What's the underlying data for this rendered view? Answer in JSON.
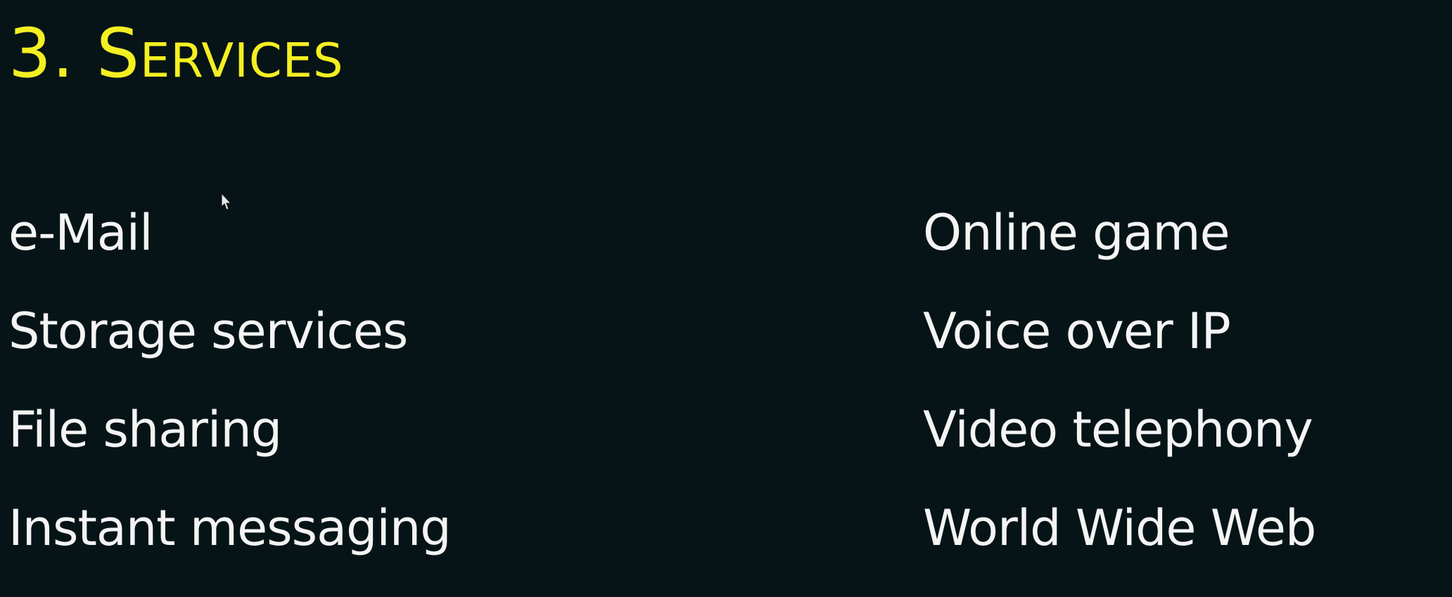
{
  "slide": {
    "title": "3. Services",
    "left_items": [
      {
        "label": "e-Mail"
      },
      {
        "label": "Storage services"
      },
      {
        "label": "File sharing"
      },
      {
        "label": "Instant messaging"
      }
    ],
    "right_items": [
      {
        "label": "Online game"
      },
      {
        "label": "Voice over IP"
      },
      {
        "label": "Video telephony"
      },
      {
        "label": "World Wide Web"
      }
    ]
  },
  "colors": {
    "background": "#061417",
    "title": "#f4ef22",
    "text": "#f4f4f4"
  },
  "icons": {
    "cursor": "mouse-pointer-icon"
  }
}
